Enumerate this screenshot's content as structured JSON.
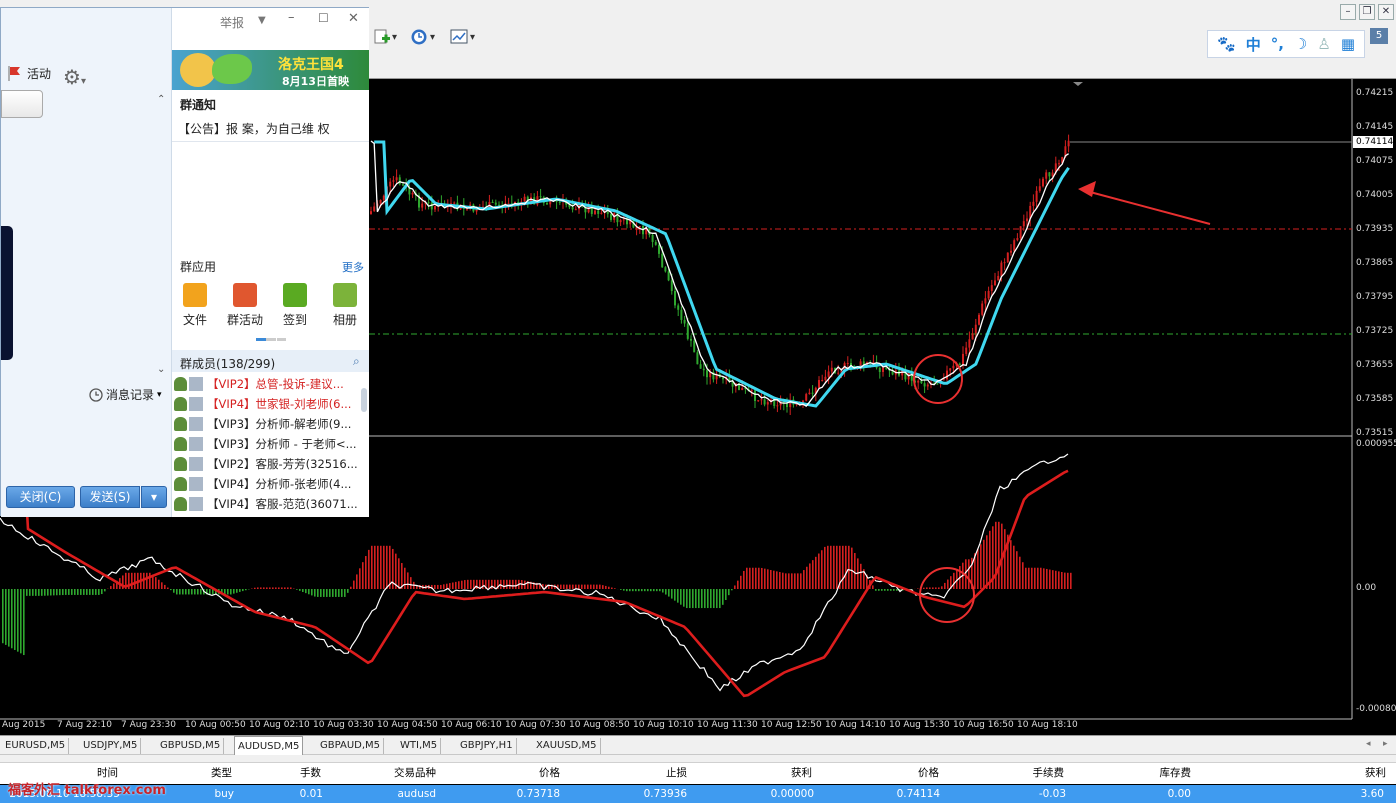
{
  "chat": {
    "header_action": "举报",
    "activity_label": "活动",
    "banner_text": "洛克王国4",
    "banner_sub": "8月13日首映",
    "notice_title": "群通知",
    "notice_text": "【公告】报 案，为自己维 权",
    "apps_title": "群应用",
    "apps_more": "更多",
    "apps": [
      "文件",
      "群活动",
      "签到",
      "相册"
    ],
    "members_title": "群成员(138/299)",
    "members": [
      {
        "text": "【VIP2】总管-投诉-建议...",
        "color": "#d42020"
      },
      {
        "text": "【VIP4】世家银-刘老师(6...",
        "color": "#d42020"
      },
      {
        "text": "【VIP3】分析师-解老师(9...",
        "color": "#222222"
      },
      {
        "text": "【VIP3】分析师 - 于老师<...",
        "color": "#222222"
      },
      {
        "text": "【VIP2】客服-芳芳(32516...",
        "color": "#222222"
      },
      {
        "text": "【VIP4】分析师-张老师(4...",
        "color": "#222222"
      },
      {
        "text": "【VIP4】客服-范范(36071...",
        "color": "#222222"
      }
    ],
    "history_label": "消息记录",
    "close_btn": "关闭(C)",
    "send_btn": "发送(S)"
  },
  "price_axis": [
    "0.74215",
    "0.74145",
    "0.74075",
    "0.74005",
    "0.73935",
    "0.73865",
    "0.73795",
    "0.73725",
    "0.73655",
    "0.73585",
    "0.73515"
  ],
  "current_price": "0.74114",
  "macd_axis": [
    "0.000955",
    "0.00",
    "-0.000806"
  ],
  "time_axis": [
    "Aug 2015",
    "7 Aug 22:10",
    "7 Aug 23:30",
    "10 Aug 00:50",
    "10 Aug 02:10",
    "10 Aug 03:30",
    "10 Aug 04:50",
    "10 Aug 06:10",
    "10 Aug 07:30",
    "10 Aug 08:50",
    "10 Aug 10:10",
    "10 Aug 11:30",
    "10 Aug 12:50",
    "10 Aug 14:10",
    "10 Aug 15:30",
    "10 Aug 16:50",
    "10 Aug 18:10"
  ],
  "symbol_tabs": [
    "EURUSD,M5",
    "USDJPY,M5",
    "GBPUSD,M5",
    "AUDUSD,M5",
    "GBPAUD,M5",
    "WTI,M5",
    "GBPJPY,H1",
    "XAUUSD,M5"
  ],
  "active_tab": "AUDUSD,M5",
  "trade_table": {
    "headers": [
      "时间",
      "类型",
      "手数",
      "交易品种",
      "价格",
      "止损",
      "获利",
      "价格",
      "手续费",
      "库存费",
      "获利"
    ],
    "row": [
      "2015.08.10 18:58:35",
      "buy",
      "0.01",
      "audusd",
      "0.73718",
      "0.73936",
      "0.00000",
      "0.74114",
      "-0.03",
      "0.00",
      "3.60"
    ]
  },
  "watermark": "福客外汇 talkforex.com",
  "taskbar_badge": "5",
  "colors": {
    "bull": "#d42020",
    "bear": "#2fa82f",
    "ma_fast": "#ffffff",
    "ma_slow": "#40d8f0",
    "annotation": "#e83030"
  }
}
